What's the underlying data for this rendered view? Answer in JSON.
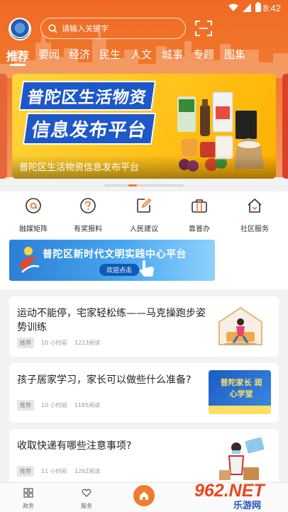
{
  "status_bar": {
    "time": "8:42"
  },
  "search": {
    "placeholder": "请输入关键字"
  },
  "tabs": [
    "推荐",
    "要闻",
    "经济",
    "民生",
    "人文",
    "城事",
    "专题",
    "图集"
  ],
  "banner": {
    "line1": "普陀区生活物资",
    "line2": "信息发布平台",
    "caption": "普陀区生活物资信息发布平台"
  },
  "quick_links": [
    "融媒矩阵",
    "有奖报料",
    "人民建议",
    "靠普办",
    "社区服务"
  ],
  "promo": {
    "title": "普陀区新时代文明实践中心平台",
    "subtitle": "欢迎点击"
  },
  "news": [
    {
      "title": "运动不能停，宅家轻松练——马克操跑步姿势训练",
      "tag": "推荐",
      "time": "10 小时前",
      "reads": "1223阅读"
    },
    {
      "title": "孩子居家学习，家长可以做些什么准备?",
      "tag": "推荐",
      "time": "10 小时前",
      "reads": "1185阅读",
      "thumb_text": "普陀家长 润心学堂"
    },
    {
      "title": "收取快递有哪些注意事项?",
      "tag": "推荐",
      "time": "11 小时前",
      "reads": "1262阅读"
    }
  ],
  "bottom_nav": [
    "政务",
    "服务"
  ],
  "watermark": {
    "brand": "962.NET",
    "site": "乐游网"
  },
  "colors": {
    "accent": "#f07a2e",
    "banner_blue": "#1e58c8",
    "banner_yellow": "#ffc21a"
  }
}
